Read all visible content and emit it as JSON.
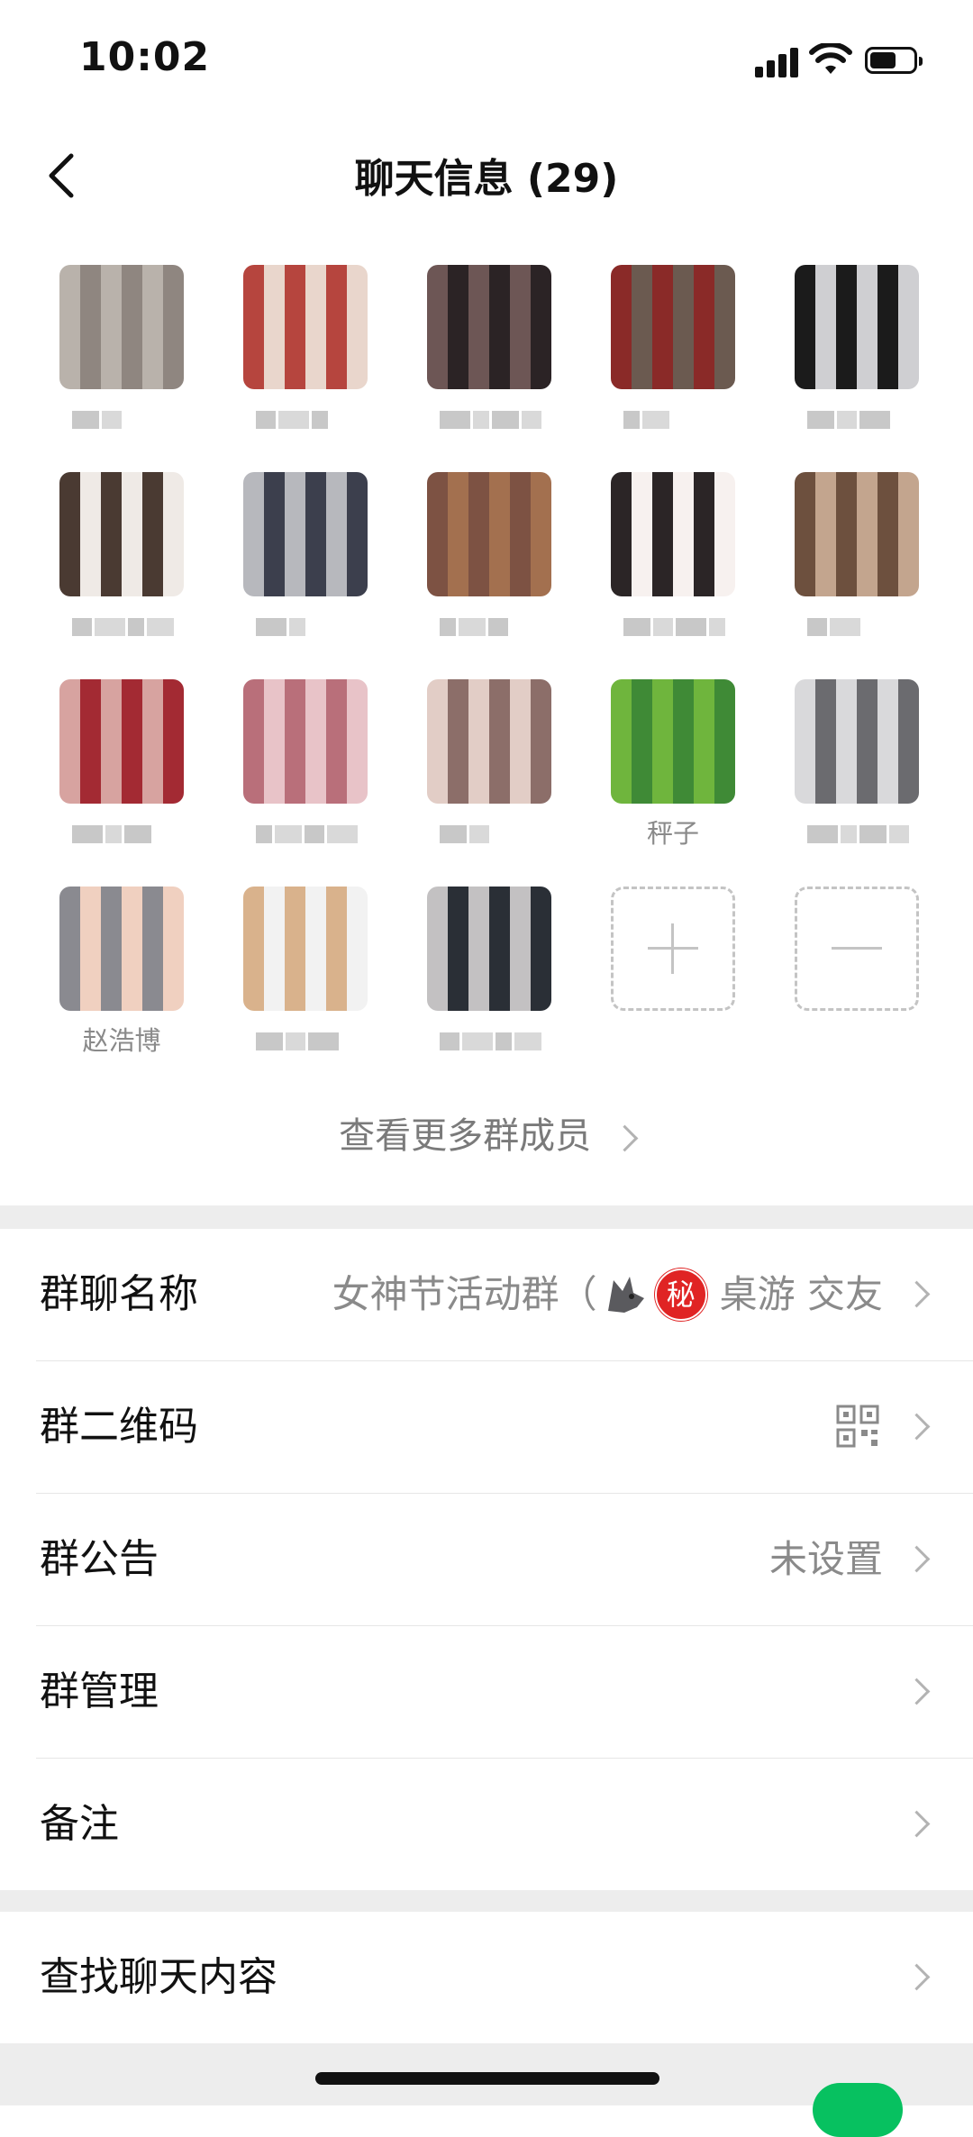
{
  "status_bar": {
    "time": "10:02",
    "battery_level": 0.6
  },
  "nav": {
    "title": "聊天信息 (29)"
  },
  "members": [
    {
      "name": "",
      "colors": [
        "#f1ece7",
        "#d9d3cd",
        "#b9b2ab",
        "#8f8680"
      ]
    },
    {
      "name": "",
      "colors": [
        "#e9d6cc",
        "#b6453e",
        "#8d2520",
        "#f4e6df"
      ]
    },
    {
      "name": "",
      "colors": [
        "#6d5655",
        "#2b2325",
        "#c7b9c0",
        "#ece1e3"
      ]
    },
    {
      "name": "",
      "colors": [
        "#c5b7a6",
        "#1f3040",
        "#6b5a50",
        "#8a2a28"
      ]
    },
    {
      "name": "",
      "colors": [
        "#7b7c80",
        "#f3f3f3",
        "#1b1b1b",
        "#cfcfd2"
      ]
    },
    {
      "name": "",
      "colors": [
        "#efeae6",
        "#4a3a32",
        "#9d9a99",
        "#d9d4cf"
      ]
    },
    {
      "name": "",
      "colors": [
        "#b7b8bd",
        "#3c3f4d",
        "#686b7c",
        "#e4e3e6"
      ]
    },
    {
      "name": "",
      "colors": [
        "#4a2e26",
        "#5aa33b",
        "#a3704f",
        "#7d5243"
      ]
    },
    {
      "name": "",
      "colors": [
        "#eeeeef",
        "#d9c9c3",
        "#2b2526",
        "#f7f1ef"
      ]
    },
    {
      "name": "",
      "colors": [
        "#c3a58e",
        "#6d503e",
        "#e6dfd9",
        "#3d3a3d"
      ]
    },
    {
      "name": "",
      "colors": [
        "#d7a3a0",
        "#a32a33",
        "#c95c64",
        "#f0d6d4"
      ]
    },
    {
      "name": "",
      "colors": [
        "#f2e3e7",
        "#6b3a36",
        "#e8c3c8",
        "#b96f7a"
      ]
    },
    {
      "name": "",
      "colors": [
        "#c39e94",
        "#5c4743",
        "#e2cdc6",
        "#8c6e69"
      ]
    },
    {
      "name": "秤子",
      "colors": [
        "#3f8a36",
        "#6fb53d",
        "#8fd6f0",
        "#2f5e2a"
      ]
    },
    {
      "name": "",
      "colors": [
        "#d9d9db",
        "#6b6b6f",
        "#f1f1f2",
        "#9a9aa0"
      ]
    },
    {
      "name": "赵浩博",
      "colors": [
        "#dcdcde",
        "#1a1a1c",
        "#f0d0c0",
        "#8a8a90"
      ]
    },
    {
      "name": "",
      "colors": [
        "#f9ec3a",
        "#f5e6dc",
        "#d9b28c",
        "#f2f2f2"
      ]
    },
    {
      "name": "",
      "colors": [
        "#2a2f36",
        "#c3c1c2",
        "#7b8288",
        "#a8b4c2"
      ]
    }
  ],
  "more_members_label": "查看更多群成员",
  "settings": {
    "group_name_label": "群聊名称",
    "group_name_value_prefix": "女神节活动群（",
    "group_name_badge": "秘",
    "group_name_value_suffix": "桌游 交友",
    "qr_label": "群二维码",
    "notice_label": "群公告",
    "notice_value": "未设置",
    "manage_label": "群管理",
    "remark_label": "备注",
    "search_label": "查找聊天内容"
  },
  "icons": [
    "back-arrow-icon",
    "signal-icon",
    "wifi-icon",
    "battery-icon",
    "add-member-icon",
    "remove-member-icon",
    "qr-code-icon",
    "chevron-right-icon",
    "wolf-emoji-icon"
  ],
  "colors": {
    "accent": "#07c160",
    "secret_badge": "#e02424",
    "section_gap": "#ededed"
  }
}
